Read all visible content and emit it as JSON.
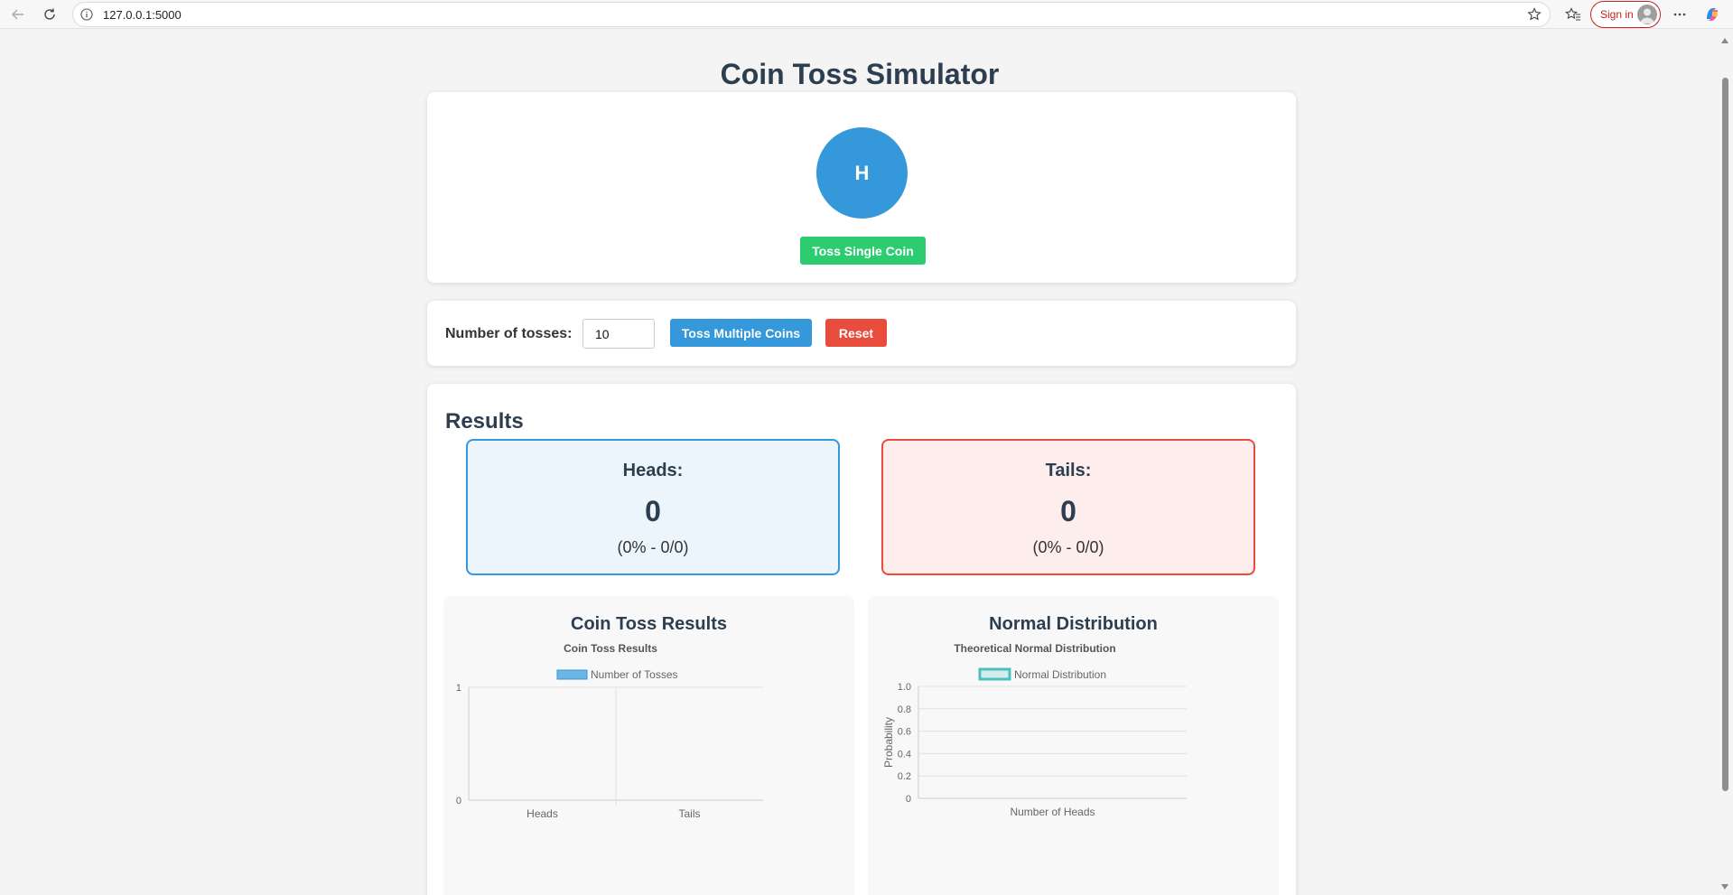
{
  "browser": {
    "url": "127.0.0.1:5000",
    "sign_in_label": "Sign in"
  },
  "page": {
    "title": "Coin Toss Simulator"
  },
  "coin": {
    "face": "H",
    "toss_single_label": "Toss Single Coin"
  },
  "controls": {
    "num_tosses_label": "Number of tosses:",
    "num_tosses_value": "10",
    "toss_multiple_label": "Toss Multiple Coins",
    "reset_label": "Reset"
  },
  "results": {
    "title": "Results",
    "heads": {
      "label": "Heads:",
      "count": "0",
      "detail": "(0% - 0/0)"
    },
    "tails": {
      "label": "Tails:",
      "count": "0",
      "detail": "(0% - 0/0)"
    }
  },
  "colors": {
    "heads": "#3498db",
    "tails": "#e74c3c",
    "single_button": "#2ecc71",
    "title": "#2c3e50",
    "normal_line": "#4bc0c0"
  },
  "chart_data": [
    {
      "type": "bar",
      "panel_title": "Coin Toss Results",
      "title": "Coin Toss Results",
      "categories": [
        "Heads",
        "Tails"
      ],
      "series": [
        {
          "name": "Number of Tosses",
          "values": [
            0,
            0
          ]
        }
      ],
      "ylim": [
        0,
        1
      ],
      "y_ticks": [
        "0",
        "1"
      ],
      "xlabel": "",
      "ylabel": "",
      "grid": true,
      "legend": "top-center",
      "color": "#3498db"
    },
    {
      "type": "line",
      "panel_title": "Normal Distribution",
      "title": "Theoretical Normal Distribution",
      "series": [
        {
          "name": "Normal Distribution",
          "x": [],
          "values": []
        }
      ],
      "ylim": [
        0,
        1.0
      ],
      "y_ticks": [
        "0",
        "0.2",
        "0.4",
        "0.6",
        "0.8",
        "1.0"
      ],
      "xlabel": "Number of Heads",
      "ylabel": "Probability",
      "grid": true,
      "legend": "top-center",
      "color": "#4bc0c0"
    }
  ]
}
